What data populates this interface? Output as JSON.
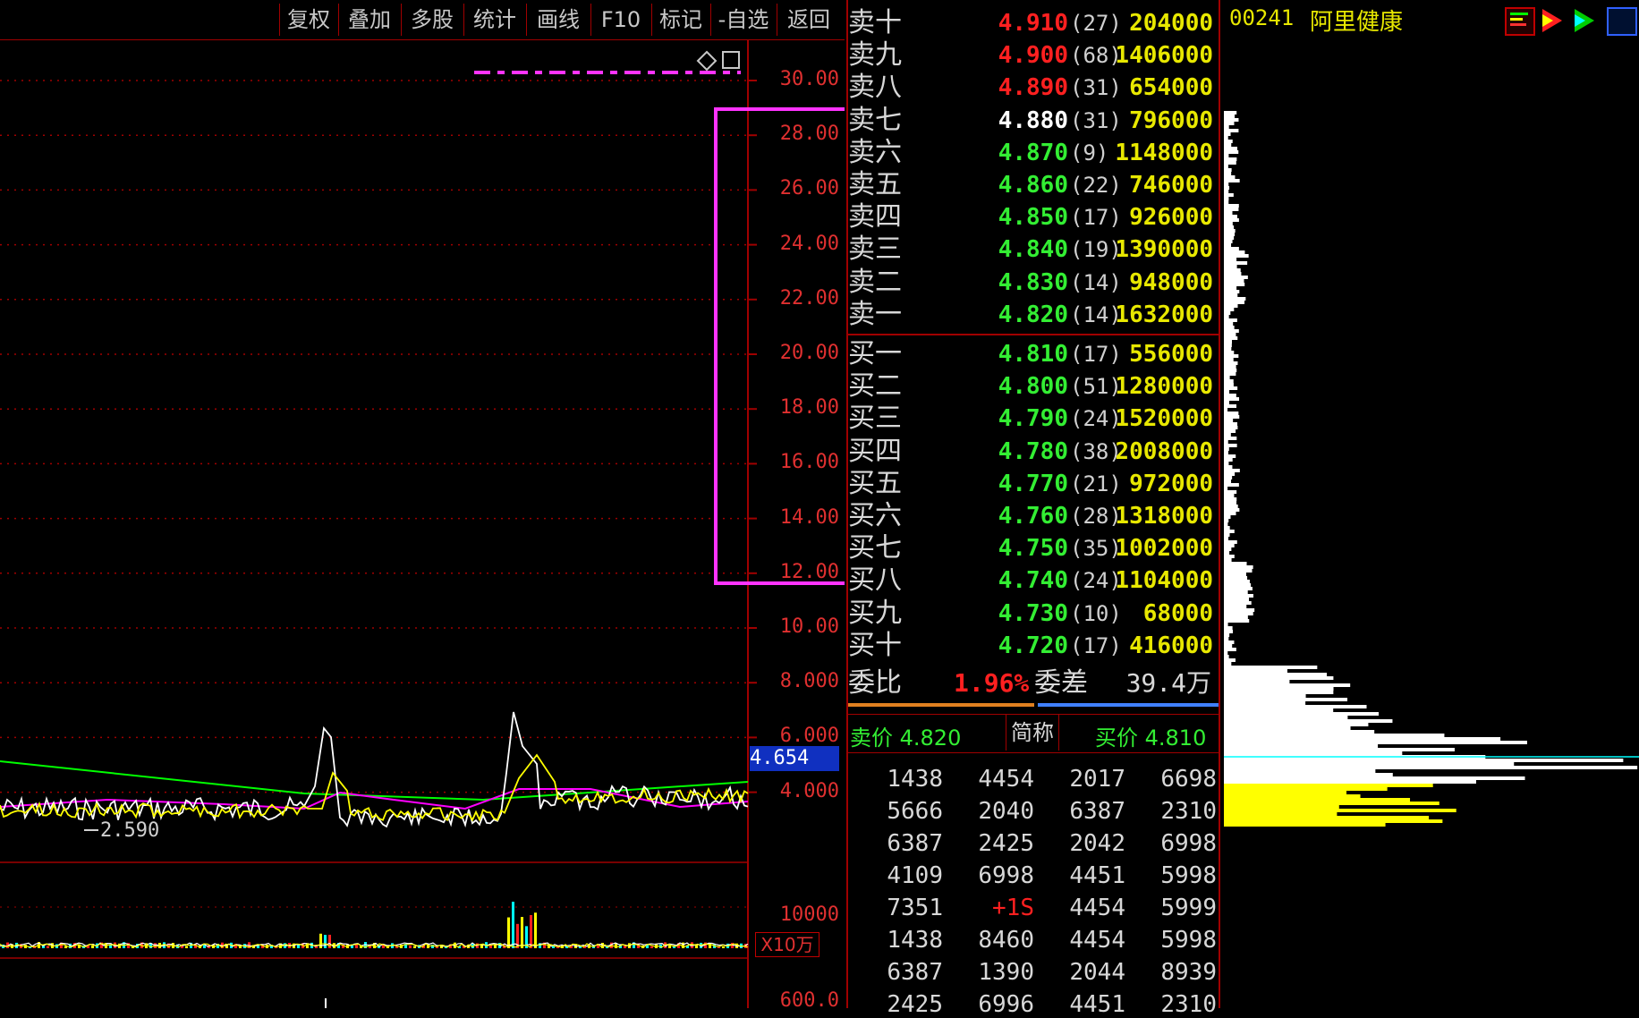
{
  "toolbar": {
    "buttons": [
      "复权",
      "叠加",
      "多股",
      "统计",
      "画线",
      "F10",
      "标记",
      "-自选",
      "返回"
    ]
  },
  "chart": {
    "y_axis": [
      "30.00",
      "28.00",
      "26.00",
      "24.00",
      "22.00",
      "20.00",
      "18.00",
      "16.00",
      "14.00",
      "12.00",
      "10.00",
      "8.000",
      "6.000",
      "4.000"
    ],
    "current_price": "4.654",
    "low_marker": "2.590",
    "volume_axis": "10000",
    "volume_unit": "X10万",
    "bottom_axis": "600.0",
    "colors": {
      "grid": "#a00000",
      "ma1": "#ffffff",
      "ma2": "#ffff00",
      "ma3": "#ff00ff",
      "ma4": "#00ff00",
      "highlight": "#ff33ff"
    }
  },
  "header": {
    "stock_code": "00241",
    "stock_name": "阿里健康"
  },
  "order_book": {
    "asks": [
      {
        "label": "卖十",
        "price": "4.910",
        "count": "(27)",
        "volume": "204000",
        "color": "#ff2020"
      },
      {
        "label": "卖九",
        "price": "4.900",
        "count": "(68)",
        "volume": "1406000",
        "color": "#ff2020"
      },
      {
        "label": "卖八",
        "price": "4.890",
        "count": "(31)",
        "volume": "654000",
        "color": "#ff2020"
      },
      {
        "label": "卖七",
        "price": "4.880",
        "count": "(31)",
        "volume": "796000",
        "color": "#ffffff"
      },
      {
        "label": "卖六",
        "price": "4.870",
        "count": "(9)",
        "volume": "1148000",
        "color": "#33ee33"
      },
      {
        "label": "卖五",
        "price": "4.860",
        "count": "(22)",
        "volume": "746000",
        "color": "#33ee33"
      },
      {
        "label": "卖四",
        "price": "4.850",
        "count": "(17)",
        "volume": "926000",
        "color": "#33ee33"
      },
      {
        "label": "卖三",
        "price": "4.840",
        "count": "(19)",
        "volume": "1390000",
        "color": "#33ee33"
      },
      {
        "label": "卖二",
        "price": "4.830",
        "count": "(14)",
        "volume": "948000",
        "color": "#33ee33"
      },
      {
        "label": "卖一",
        "price": "4.820",
        "count": "(14)",
        "volume": "1632000",
        "color": "#33ee33"
      }
    ],
    "bids": [
      {
        "label": "买一",
        "price": "4.810",
        "count": "(17)",
        "volume": "556000",
        "color": "#33ee33"
      },
      {
        "label": "买二",
        "price": "4.800",
        "count": "(51)",
        "volume": "1280000",
        "color": "#33ee33"
      },
      {
        "label": "买三",
        "price": "4.790",
        "count": "(24)",
        "volume": "1520000",
        "color": "#33ee33"
      },
      {
        "label": "买四",
        "price": "4.780",
        "count": "(38)",
        "volume": "2008000",
        "color": "#33ee33"
      },
      {
        "label": "买五",
        "price": "4.770",
        "count": "(21)",
        "volume": "972000",
        "color": "#33ee33"
      },
      {
        "label": "买六",
        "price": "4.760",
        "count": "(28)",
        "volume": "1318000",
        "color": "#33ee33"
      },
      {
        "label": "买七",
        "price": "4.750",
        "count": "(35)",
        "volume": "1002000",
        "color": "#33ee33"
      },
      {
        "label": "买八",
        "price": "4.740",
        "count": "(24)",
        "volume": "1104000",
        "color": "#33ee33"
      },
      {
        "label": "买九",
        "price": "4.730",
        "count": "(10)",
        "volume": "68000",
        "color": "#33ee33"
      },
      {
        "label": "买十",
        "price": "4.720",
        "count": "(17)",
        "volume": "416000",
        "color": "#33ee33"
      }
    ],
    "ratio_label": "委比",
    "ratio_value": "1.96%",
    "diff_label": "委差",
    "diff_value": "39.4万"
  },
  "quote_bar": {
    "ask": "卖价 4.820",
    "name": "简称",
    "bid": "买价 4.810"
  },
  "ticks": [
    [
      "1438",
      "4454",
      "2017",
      "6698"
    ],
    [
      "5666",
      "2040",
      "6387",
      "2310"
    ],
    [
      "6387",
      "2425",
      "2042",
      "6998"
    ],
    [
      "4109",
      "6998",
      "4451",
      "5998"
    ],
    [
      "7351",
      "+1S",
      "4454",
      "5999"
    ],
    [
      "1438",
      "8460",
      "4454",
      "5998"
    ],
    [
      "6387",
      "1390",
      "2044",
      "8939"
    ],
    [
      "2425",
      "6996",
      "4451",
      "2310"
    ]
  ]
}
